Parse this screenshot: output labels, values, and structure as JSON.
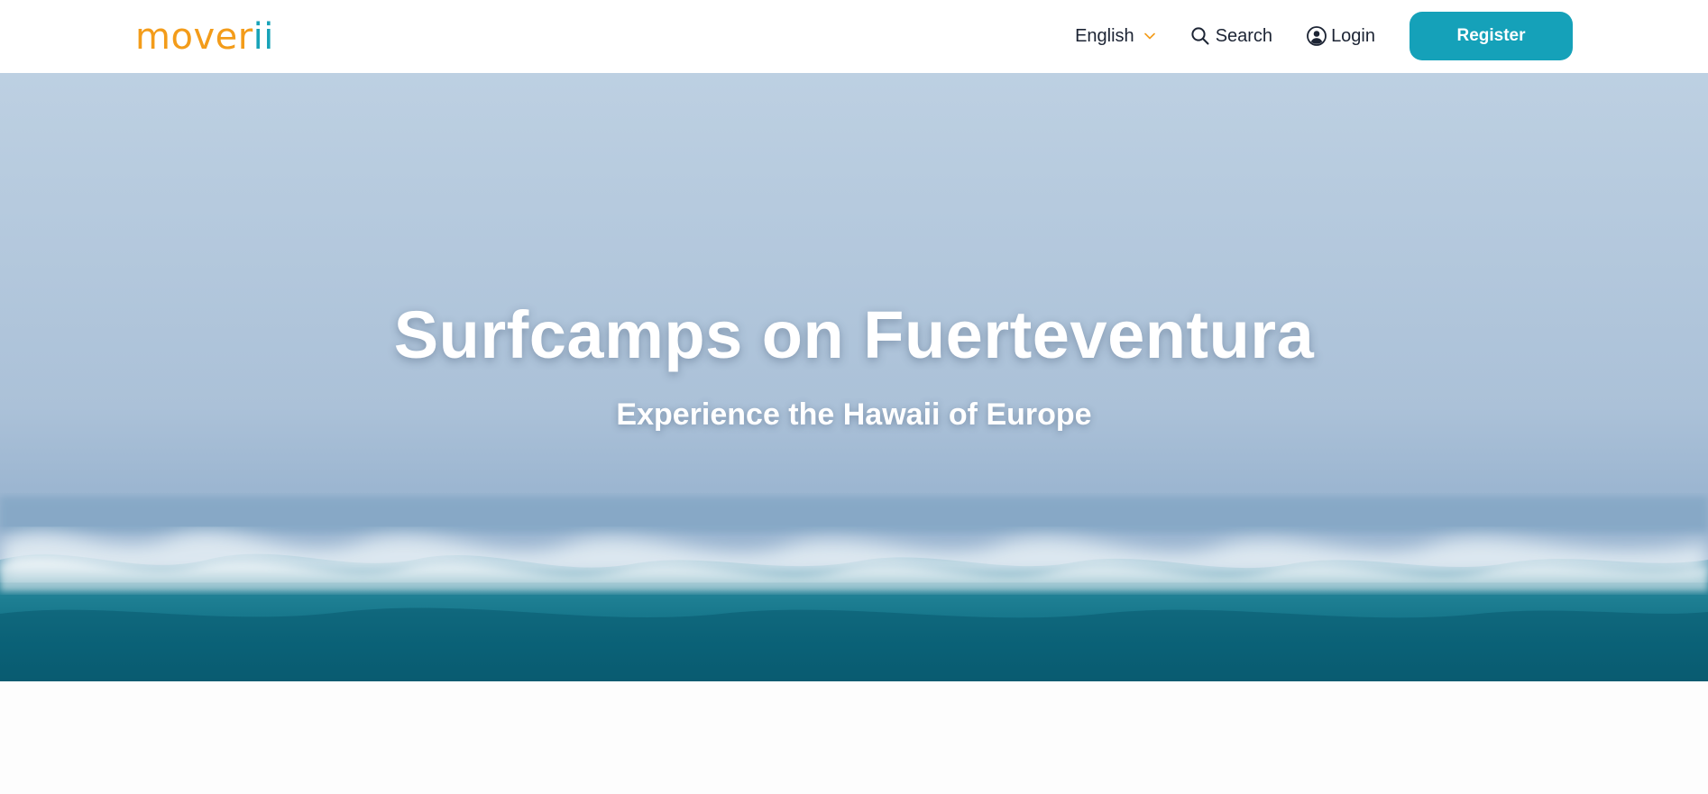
{
  "header": {
    "logo_main": "mover",
    "logo_accent": "ii",
    "language": "English",
    "search_label": "Search",
    "login_label": "Login",
    "register_label": "Register"
  },
  "hero": {
    "title": "Surfcamps on Fuerteventura",
    "subtitle": "Experience the Hawaii of Europe"
  },
  "icons": {
    "language_dropdown": "chevron-down-icon",
    "search": "search-icon",
    "login": "user-circle-icon"
  },
  "colors": {
    "brand_orange": "#f39c1a",
    "brand_teal": "#15a1b9",
    "nav_text": "#1c2434",
    "hero_text": "#ffffff"
  }
}
